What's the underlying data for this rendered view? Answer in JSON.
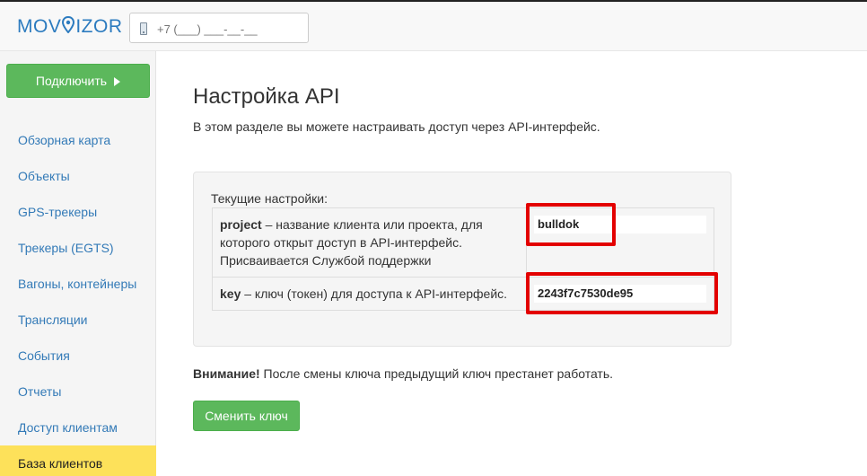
{
  "header": {
    "logo_text_1": "MOV",
    "logo_text_2": "IZOR",
    "phone_icon": "mobile-phone-icon",
    "phone_placeholder": "+7 (___) ___-__-__"
  },
  "sidebar": {
    "connect_label": "Подключить",
    "connect_icon": "play-icon",
    "items": [
      {
        "label": "Обзорная карта"
      },
      {
        "label": "Объекты"
      },
      {
        "label": "GPS-трекеры"
      },
      {
        "label": "Трекеры (EGTS)"
      },
      {
        "label": "Вагоны, контейнеры"
      },
      {
        "label": "Трансляции"
      },
      {
        "label": "События"
      },
      {
        "label": "Отчеты"
      },
      {
        "label": "Доступ клиентам"
      },
      {
        "label": "База клиентов"
      }
    ],
    "active_item": "База клиентов"
  },
  "main": {
    "title": "Настройка API",
    "description": "В этом разделе вы можете настраивать доступ через API-интерфейс.",
    "settings_caption": "Текущие настройки:",
    "rows": [
      {
        "key": "project",
        "desc_line1": " – название клиента или проекта, для",
        "desc_line2": "которого открыт доступ в API-интерфейс.",
        "desc_line3": "Присваивается Службой поддержки",
        "value": "bulldok"
      },
      {
        "key": "key",
        "desc_line1": " – ключ (токен) для доступа к API-интерфейс.",
        "value": "2243f7c7530de95"
      }
    ],
    "warning_bold": "Внимание!",
    "warning_text": " После смены ключа предыдущий ключ престанет работать.",
    "change_button": "Сменить ключ"
  },
  "colors": {
    "brand": "#2c7bbf",
    "button_green": "#5cb85c",
    "active_nav": "#fde15a",
    "highlight": "#e30000",
    "link": "#337ab7"
  }
}
